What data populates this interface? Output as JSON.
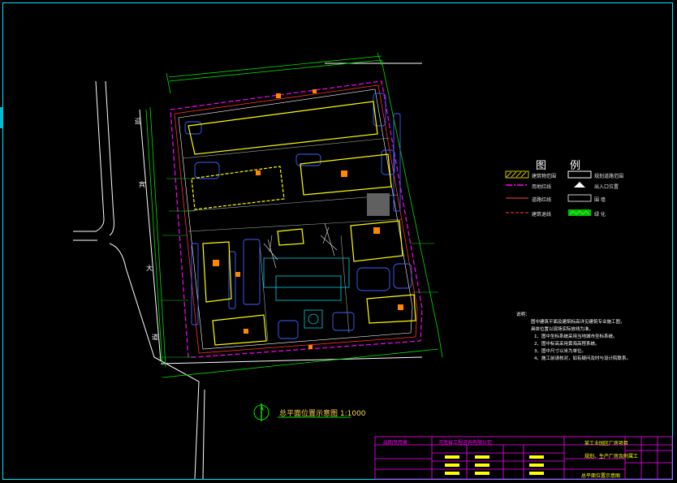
{
  "legend": {
    "title_left": "图",
    "title_right": "例",
    "items": [
      {
        "label": "建筑物范围",
        "color": "#d4c400"
      },
      {
        "label": "用地红线",
        "color": "#ff00ff"
      },
      {
        "label": "道路红线",
        "color": "#ff4040"
      },
      {
        "label": "建筑退线",
        "color": "#ff4040"
      },
      {
        "label": "规划道路范围",
        "color": "#ffffff"
      },
      {
        "label": "出入口位置",
        "color": "#ffffff"
      },
      {
        "label": "围  墙",
        "color": "#ffffff"
      },
      {
        "label": "绿  化",
        "color": "#00e000"
      }
    ]
  },
  "road": {
    "chars": [
      "迎",
      "宾",
      "大",
      "道"
    ]
  },
  "drawing_title": "总平面位置示意图 1:1000",
  "notes": {
    "heading": "说明：",
    "lines": [
      "图中建筑平面及建筑标高详见建筑专业施工图，",
      "具体位置以现场实际放线为准。",
      "1、图中坐标系统采用当地城市坐标系统。",
      "2、图中标高采用黄海高程系统。",
      "3、图中尺寸以米为单位。",
      "4、施工前请核对，如有疑问及时与设计院联系。"
    ]
  },
  "title_block": {
    "company": "河南省工程咨询有限公司",
    "project": "某工业园区厂房项目",
    "drawing_name": "总平面位置示意图",
    "sub_title": "规划、生产厂房及附属工",
    "stamp": "出图专用章"
  },
  "colors": {
    "frame": "#00e5ff",
    "boundary": "#ff00ff",
    "dimension": "#00e000",
    "building": "#ffff00",
    "road": "#ffffff",
    "accent": "#ff8800",
    "parking": "#4060ff"
  }
}
